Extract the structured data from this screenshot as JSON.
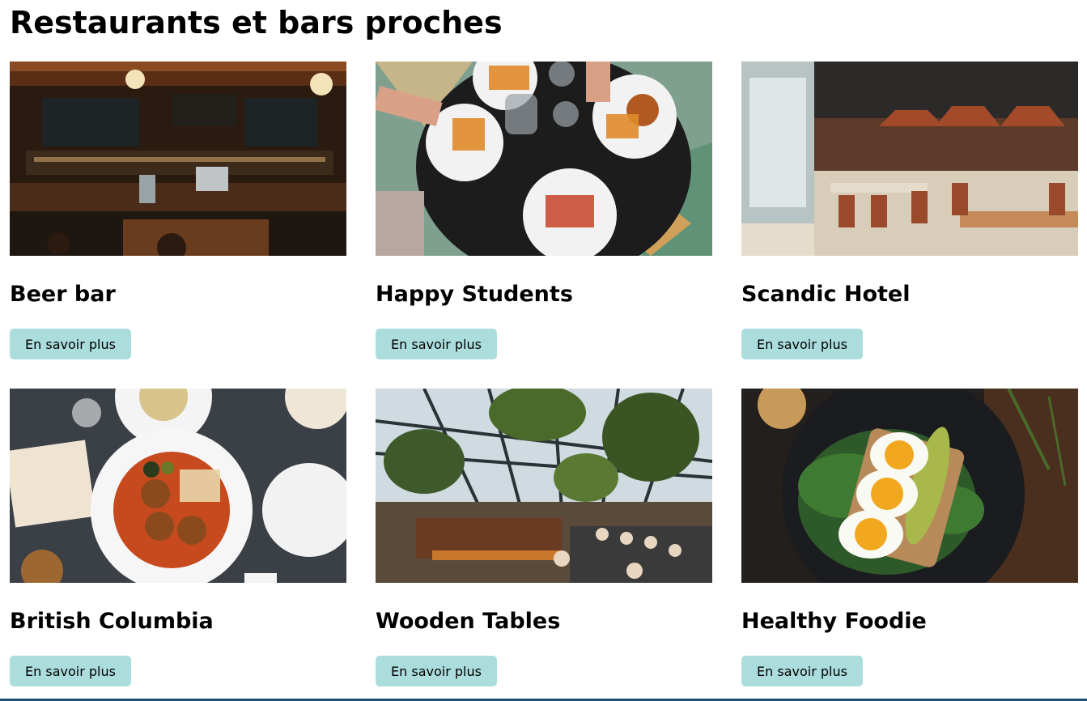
{
  "page": {
    "title": "Restaurants et bars proches"
  },
  "cards": [
    {
      "name": "Beer bar",
      "button_label": "En savoir plus",
      "image": "beer-bar-photo"
    },
    {
      "name": "Happy Students",
      "button_label": "En savoir plus",
      "image": "shared-meal-table-photo"
    },
    {
      "name": "Scandic Hotel",
      "button_label": "En savoir plus",
      "image": "hotel-restaurant-interior-photo"
    },
    {
      "name": "British Columbia",
      "button_label": "En savoir plus",
      "image": "meatball-plate-photo"
    },
    {
      "name": "Wooden Tables",
      "button_label": "En savoir plus",
      "image": "greenhouse-restaurant-photo"
    },
    {
      "name": "Healthy Foodie",
      "button_label": "En savoir plus",
      "image": "egg-avocado-toast-photo"
    }
  ],
  "colors": {
    "button_background": "#acdddd",
    "bottom_border": "#1f4e79"
  }
}
